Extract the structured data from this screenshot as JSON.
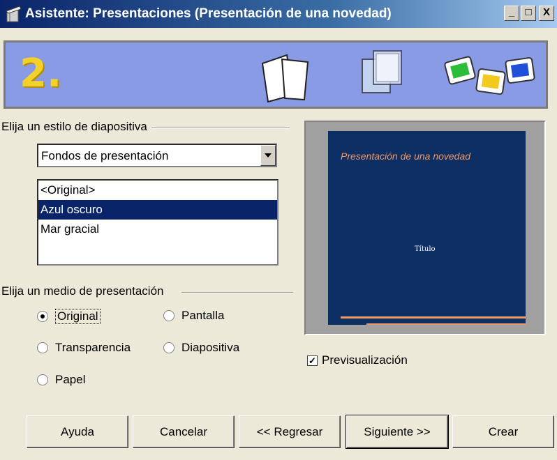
{
  "window": {
    "title": "Asistente: Presentaciones (Presentación de una novedad)",
    "minimize": "_",
    "maximize": "□",
    "close": "X"
  },
  "banner": {
    "step": "2."
  },
  "style_group": {
    "label": "Elija un estilo de diapositiva",
    "combo_value": "Fondos de presentación",
    "list_items": [
      "<Original>",
      "Azul oscuro",
      "Mar gracial"
    ],
    "selected_index": 1
  },
  "medium_group": {
    "label": "Elija un medio de presentación",
    "options": [
      "Original",
      "Pantalla",
      "Transparencia",
      "Diapositiva",
      "Papel"
    ],
    "selected": "Original"
  },
  "preview": {
    "slide_title": "Presentación de una novedad",
    "slide_subtitle": "Título",
    "checkbox_label": "Previsualización",
    "checkbox_checked": true
  },
  "buttons": {
    "help": "Ayuda",
    "cancel": "Cancelar",
    "back": "<< Regresar",
    "next": "Siguiente >>",
    "create": "Crear"
  },
  "colors": {
    "banner": "#8a9be6",
    "selection": "#0a246a",
    "slide_background": "#0d2f63",
    "slide_accent": "#ee9966",
    "step_number": "#f2d22a"
  },
  "icons": [
    "wizard-icon",
    "blank-slides-icon",
    "transparent-slides-icon",
    "color-slides-icon"
  ]
}
